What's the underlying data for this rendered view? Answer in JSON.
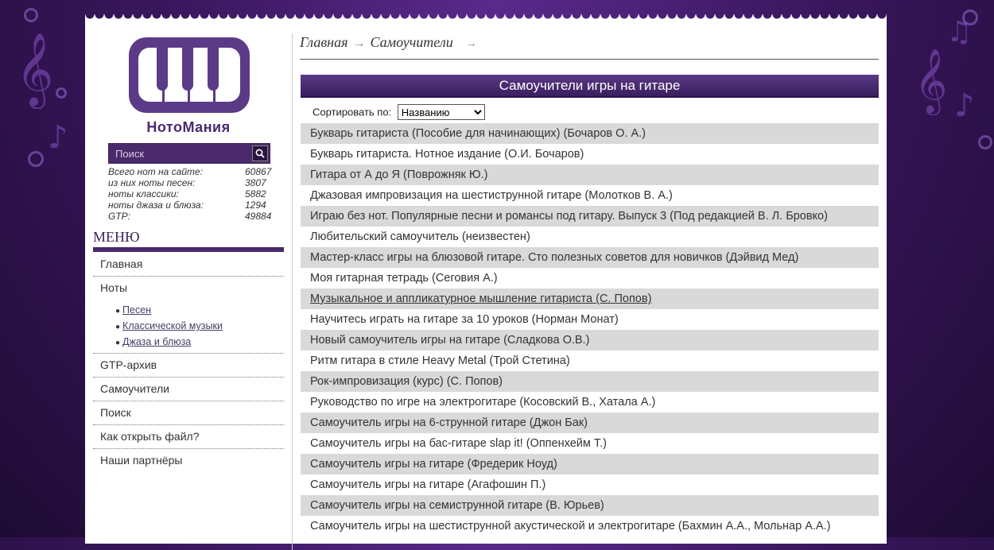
{
  "site": {
    "name": "НотоМания"
  },
  "search": {
    "placeholder": "Поиск"
  },
  "stats": [
    {
      "label": "Всего нот на сайте:",
      "value": "60867"
    },
    {
      "label": "из них ноты песен:",
      "value": "3807"
    },
    {
      "label": "ноты классики:",
      "value": "5882"
    },
    {
      "label": "ноты джаза и блюза:",
      "value": "1294"
    },
    {
      "label": "GTP:",
      "value": "49884"
    }
  ],
  "menu": {
    "title": "МЕНЮ",
    "items": [
      {
        "label": "Главная"
      },
      {
        "label": "Ноты"
      },
      {
        "label": "GTP-архив"
      },
      {
        "label": "Самоучители"
      },
      {
        "label": "Поиск"
      },
      {
        "label": "Как открыть файл?"
      },
      {
        "label": "Наши партнёры"
      }
    ],
    "notes_sub": [
      {
        "label": "Песен"
      },
      {
        "label": "Классической музыки"
      },
      {
        "label": "Джаза и блюза"
      }
    ]
  },
  "breadcrumb": {
    "home": "Главная",
    "current": "Самоучители"
  },
  "main": {
    "title": "Самоучители игры на гитаре",
    "sort_label": "Сортировать по:",
    "sort_selected": "Названию"
  },
  "books": [
    "Букварь гитариста (Пособие для начинающих) (Бочаров О. А.)",
    "Букварь гитариста. Нотное издание (О.И. Бочаров)",
    "Гитара от А до Я (Поврожняк Ю.)",
    "Джазовая импровизация на шестиструнной гитаре (Молотков В. А.)",
    "Играю без нот. Популярные песни и романсы под гитару. Выпуск 3 (Под редакцией В. Л. Бровко)",
    "Любительский самоучитель (неизвестен)",
    "Мастер-класс игры на блюзовой гитаре. Сто полезных советов для новичков (Дэйвид Мед)",
    "Моя гитарная тетрадь (Сеговия А.)",
    "Музыкальное и аппликатурное мышление гитариста (С. Попов)",
    "Научитесь играть на гитаре за 10 уроков (Норман Монат)",
    "Новый самоучитель игры на гитаре (Сладкова О.В.)",
    "Ритм гитара в стиле Heavy Metal (Трой Стетина)",
    "Рок-импровизация (курс) (С. Попов)",
    "Руководство по игре на электрогитаре (Косовский В., Хатала А.)",
    "Самоучитель игры на 6-струнной гитаре (Джон Бак)",
    "Самоучитель игры на бас-гитаре slap it! (Оппенхейм Т.)",
    "Самоучитель игры на гитаре (Фредерик Ноуд)",
    "Самоучитель игры на гитаре (Агафошин П.)",
    "Самоучитель игры на семиструнной гитаре (В. Юрьев)",
    "Самоучитель игры на шестиструнной акустической и электрогитаре (Бахмин А.А., Мольнар А.А.)"
  ]
}
